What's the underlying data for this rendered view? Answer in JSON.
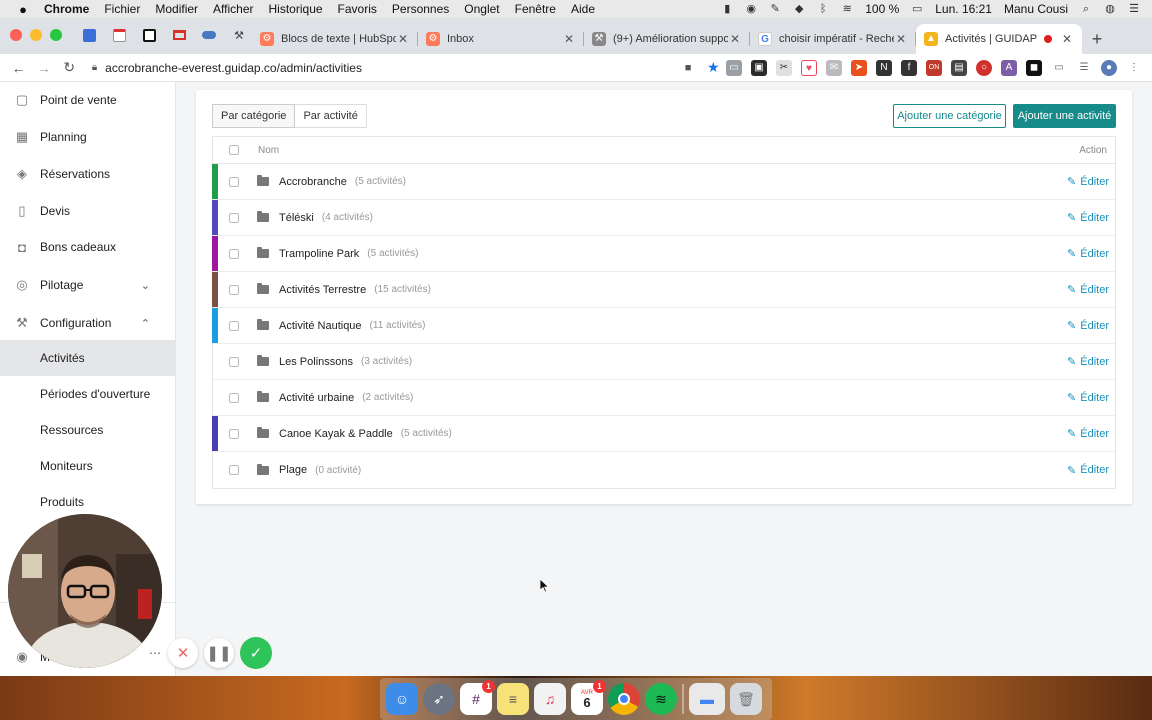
{
  "menubar": {
    "app": "Chrome",
    "items": [
      "Fichier",
      "Modifier",
      "Afficher",
      "Historique",
      "Favoris",
      "Personnes",
      "Onglet",
      "Fenêtre",
      "Aide"
    ],
    "battery": "100 %",
    "clock": "Lun. 16:21",
    "user": "Manu Cousi"
  },
  "tabs": [
    {
      "title": "Blocs de texte | HubSpot",
      "favicon": "hubspot-icon"
    },
    {
      "title": "Inbox",
      "favicon": "hubspot-icon"
    },
    {
      "title": "(9+) Amélioration suppor",
      "favicon": "wrench-icon"
    },
    {
      "title": "choisir impératif - Recher",
      "favicon": "google-icon"
    },
    {
      "title": "Activités | GUIDAP",
      "favicon": "guidap-icon",
      "active": true
    }
  ],
  "toolbar": {
    "url": "accrobranche-everest.guidap.co/admin/activities"
  },
  "sidebar": {
    "items": [
      {
        "label": "Point de vente",
        "icon": "basket-icon"
      },
      {
        "label": "Planning",
        "icon": "calendar-icon"
      },
      {
        "label": "Réservations",
        "icon": "tag-icon"
      },
      {
        "label": "Devis",
        "icon": "document-icon"
      },
      {
        "label": "Bons cadeaux",
        "icon": "gift-icon"
      },
      {
        "label": "Pilotage",
        "icon": "gauge-icon"
      },
      {
        "label": "Configuration",
        "icon": "wrench-icon"
      }
    ],
    "sub_items": [
      {
        "label": "Activités",
        "active": true
      },
      {
        "label": "Périodes d'ouverture"
      },
      {
        "label": "Ressources"
      },
      {
        "label": "Moniteurs"
      },
      {
        "label": "Produits"
      }
    ],
    "footer_label": "M"
  },
  "main": {
    "segments": [
      "Par catégorie",
      "Par activité"
    ],
    "add_category_label": "Ajouter une catégorie",
    "add_activity_label": "Ajouter une activité",
    "columns": {
      "name": "Nom",
      "action": "Action"
    },
    "edit_label": "Éditer",
    "rows": [
      {
        "name": "Accrobranche",
        "count": "(5 activités)",
        "color": "#1e9e4a"
      },
      {
        "name": "Téléski",
        "count": "(4 activités)",
        "color": "#5548b8"
      },
      {
        "name": "Trampoline Park",
        "count": "(5 activités)",
        "color": "#a0159e"
      },
      {
        "name": "Activités Terrestre",
        "count": "(15 activités)",
        "color": "#7a5040"
      },
      {
        "name": "Activité Nautique",
        "count": "(11 activités)",
        "color": "#1a9ee0"
      },
      {
        "name": "Les Polinssons",
        "count": "(3 activités)",
        "color": ""
      },
      {
        "name": "Activité urbaine",
        "count": "(2 activités)",
        "color": ""
      },
      {
        "name": "Canoe Kayak & Paddle",
        "count": "(5 activités)",
        "color": "#4a3fb0"
      },
      {
        "name": "Plage",
        "count": "(0 activité)",
        "color": ""
      }
    ]
  },
  "colors": {
    "accent": "#178a8a",
    "link": "#1a8fb5"
  },
  "dock_badges": {
    "slack": "1",
    "calendar": "1"
  },
  "dock_calendar": {
    "month": "AVR",
    "day": "6"
  }
}
